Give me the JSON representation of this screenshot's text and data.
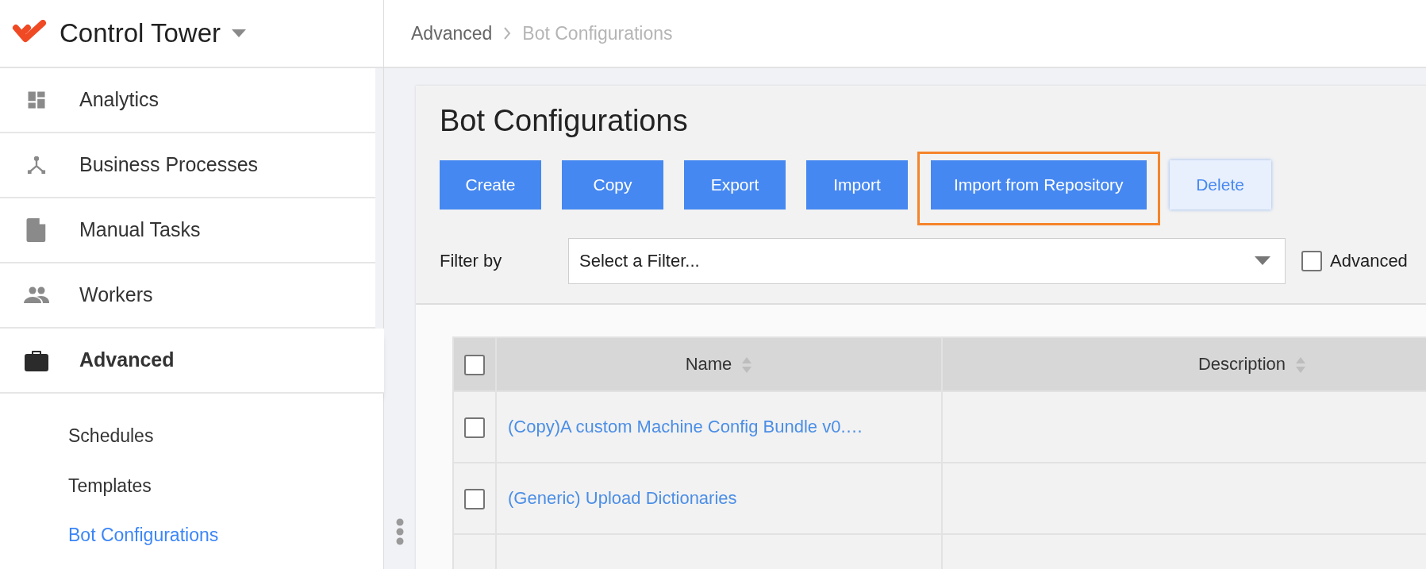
{
  "app": {
    "title": "Control Tower"
  },
  "sidebar": {
    "items": [
      {
        "label": "Analytics",
        "selected": false
      },
      {
        "label": "Business Processes",
        "selected": false
      },
      {
        "label": "Manual Tasks",
        "selected": false
      },
      {
        "label": "Workers",
        "selected": false
      },
      {
        "label": "Advanced",
        "selected": true,
        "children": [
          {
            "label": "Schedules",
            "selected": false
          },
          {
            "label": "Templates",
            "selected": false
          },
          {
            "label": "Bot Configurations",
            "selected": true
          }
        ]
      }
    ]
  },
  "breadcrumb": [
    {
      "label": "Advanced",
      "current": false
    },
    {
      "label": "Bot Configurations",
      "current": true
    }
  ],
  "page": {
    "title": "Bot Configurations"
  },
  "buttons": [
    {
      "label": "Create",
      "disabled": false,
      "highlighted": false
    },
    {
      "label": "Copy",
      "disabled": false,
      "highlighted": false
    },
    {
      "label": "Export",
      "disabled": false,
      "highlighted": false
    },
    {
      "label": "Import",
      "disabled": false,
      "highlighted": false
    },
    {
      "label": "Import from Repository",
      "disabled": false,
      "highlighted": true
    },
    {
      "label": "Delete",
      "disabled": true,
      "highlighted": false
    }
  ],
  "filter": {
    "label": "Filter by",
    "placeholder": "Select a Filter...",
    "advanced": {
      "label": "Advanced",
      "checked": false
    }
  },
  "table": {
    "select_all_checked": false,
    "columns": [
      "Name",
      "Description"
    ],
    "rows": [
      {
        "checked": false,
        "name": "(Copy)A custom Machine Config Bundle v0.…"
      },
      {
        "checked": false,
        "name": "(Generic) Upload Dictionaries"
      }
    ]
  }
}
